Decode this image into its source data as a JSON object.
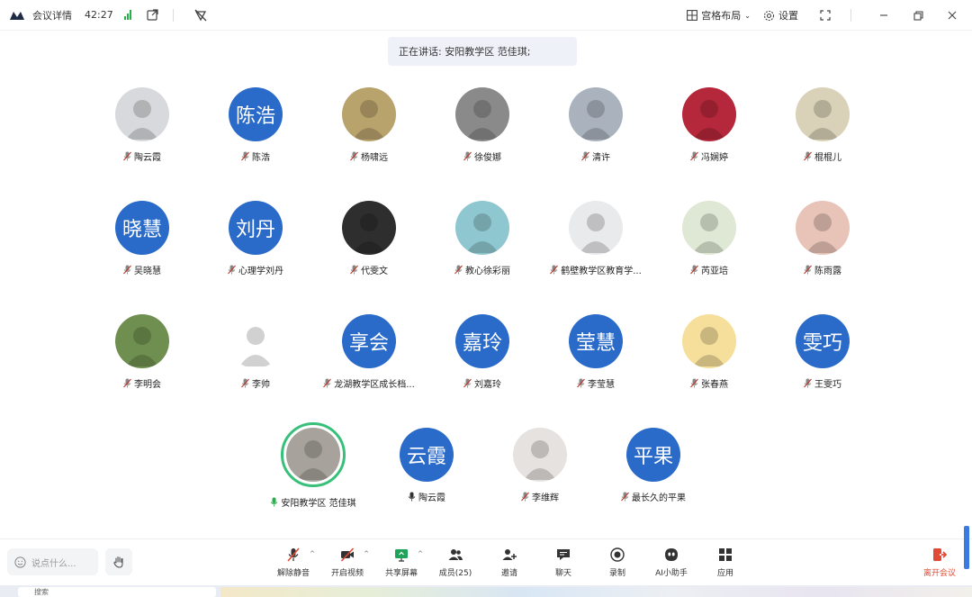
{
  "topbar": {
    "title": "会议详情",
    "time": "42:27",
    "layout_label": "宫格布局",
    "settings_label": "设置"
  },
  "speaking": {
    "text": "正在讲话: 安阳教学区 范佳琪;"
  },
  "participants": [
    {
      "name": "陶云霞",
      "avatar_text": "",
      "avatar_color": "#d7d9dc"
    },
    {
      "name": "陈浩",
      "avatar_text": "陈浩",
      "avatar_color": "#2a6bc9"
    },
    {
      "name": "杨啸远",
      "avatar_text": "",
      "avatar_color": "#b9a36d"
    },
    {
      "name": "徐俊娜",
      "avatar_text": "",
      "avatar_color": "#8a8a8a"
    },
    {
      "name": "清许",
      "avatar_text": "",
      "avatar_color": "#aab3bd"
    },
    {
      "name": "冯娴婷",
      "avatar_text": "",
      "avatar_color": "#b5273a"
    },
    {
      "name": "棍棍儿",
      "avatar_text": "",
      "avatar_color": "#d9d2b8"
    },
    {
      "name": "吴晓慧",
      "avatar_text": "晓慧",
      "avatar_color": "#2a6bc9"
    },
    {
      "name": "心理学刘丹",
      "avatar_text": "刘丹",
      "avatar_color": "#2a6bc9"
    },
    {
      "name": "代雯文",
      "avatar_text": "",
      "avatar_color": "#2e2e2e"
    },
    {
      "name": "教心徐彩丽",
      "avatar_text": "",
      "avatar_color": "#8ec7cf"
    },
    {
      "name": "鹤壁教学区教育学...",
      "avatar_text": "",
      "avatar_color": "#e9eaec"
    },
    {
      "name": "芮亚培",
      "avatar_text": "",
      "avatar_color": "#dfe8d4"
    },
    {
      "name": "陈雨露",
      "avatar_text": "",
      "avatar_color": "#e8c3b7"
    },
    {
      "name": "李明会",
      "avatar_text": "",
      "avatar_color": "#6e8f4f"
    },
    {
      "name": "李帅",
      "avatar_text": "",
      "avatar_color": "#ffffff"
    },
    {
      "name": "龙湖教学区成长档...",
      "avatar_text": "享会",
      "avatar_color": "#2a6bc9"
    },
    {
      "name": "刘嘉玲",
      "avatar_text": "嘉玲",
      "avatar_color": "#2a6bc9"
    },
    {
      "name": "李莹慧",
      "avatar_text": "莹慧",
      "avatar_color": "#2a6bc9"
    },
    {
      "name": "张春燕",
      "avatar_text": "",
      "avatar_color": "#f5df9a"
    },
    {
      "name": "王雯巧",
      "avatar_text": "雯巧",
      "avatar_color": "#2a6bc9"
    },
    {
      "name": "安阳教学区 范佳琪",
      "avatar_text": "",
      "avatar_color": "#a7a39c"
    },
    {
      "name": "陶云霞",
      "avatar_text": "云霞",
      "avatar_color": "#2a6bc9"
    },
    {
      "name": "李维辉",
      "avatar_text": "",
      "avatar_color": "#e6e2df"
    },
    {
      "name": "最长久的平果",
      "avatar_text": "平果",
      "avatar_color": "#2a6bc9"
    }
  ],
  "bottombar": {
    "say_placeholder": "说点什么...",
    "tools": [
      {
        "label": "解除静音",
        "icon": "mic-muted-icon"
      },
      {
        "label": "开启视频",
        "icon": "video-off-icon"
      },
      {
        "label": "共享屏幕",
        "icon": "share-screen-icon"
      },
      {
        "label": "成员(25)",
        "icon": "members-icon"
      },
      {
        "label": "邀请",
        "icon": "invite-icon"
      },
      {
        "label": "聊天",
        "icon": "chat-icon"
      },
      {
        "label": "录制",
        "icon": "record-icon"
      },
      {
        "label": "AI小助手",
        "icon": "ai-assistant-icon"
      },
      {
        "label": "应用",
        "icon": "apps-icon"
      }
    ],
    "leave_label": "离开会议"
  },
  "taskbar": {
    "search_text": "搜索"
  },
  "colors": {
    "accent": "#2a6bc9",
    "speaking_ring": "#38c07a",
    "leave": "#e24a35"
  }
}
